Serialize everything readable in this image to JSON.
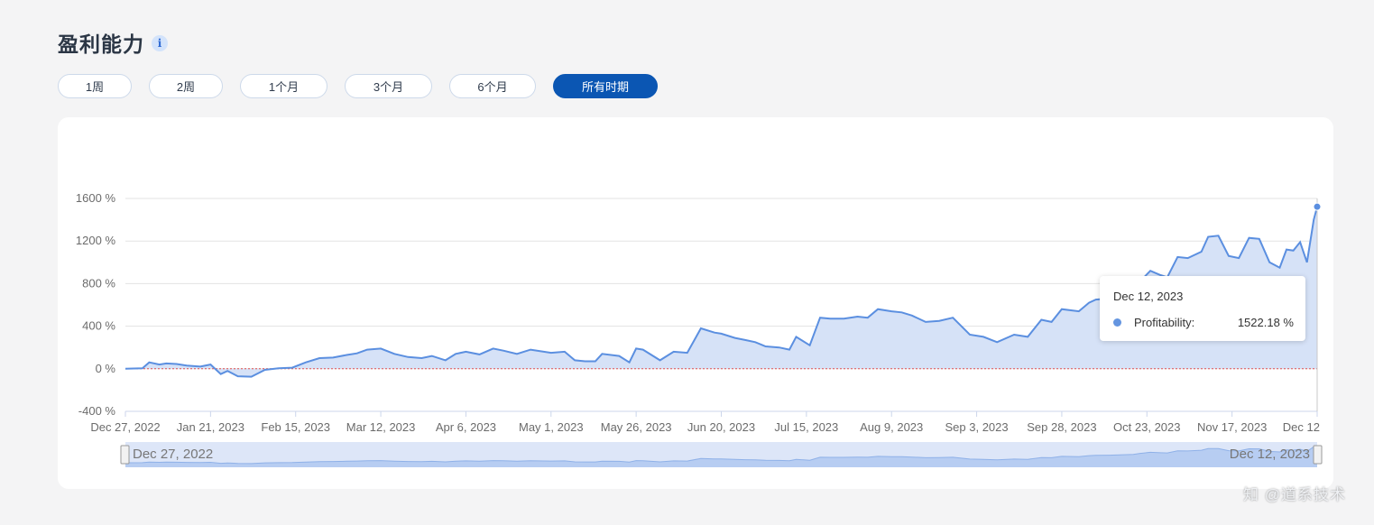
{
  "header": {
    "title": "盈利能力",
    "info_icon": "info-icon"
  },
  "periods": [
    {
      "label": "1周",
      "active": false
    },
    {
      "label": "2周",
      "active": false
    },
    {
      "label": "1个月",
      "active": false
    },
    {
      "label": "3个月",
      "active": false
    },
    {
      "label": "6个月",
      "active": false
    },
    {
      "label": "所有时期",
      "active": true
    }
  ],
  "colors": {
    "line": "#5b8fe0",
    "area": "#d6e2f7",
    "zero_line": "#e05050",
    "active_button": "#0b56b3"
  },
  "chart_data": {
    "type": "area",
    "title": "",
    "xlabel": "",
    "ylabel": "",
    "ylim": [
      -400,
      1600
    ],
    "yticks": [
      "1600 %",
      "1200 %",
      "800 %",
      "400 %",
      "0 %",
      "-400 %"
    ],
    "xticks": [
      "Dec 27, 2022",
      "Jan 21, 2023",
      "Feb 15, 2023",
      "Mar 12, 2023",
      "Apr 6, 2023",
      "May 1, 2023",
      "May 26, 2023",
      "Jun 20, 2023",
      "Jul 15, 2023",
      "Aug 9, 2023",
      "Sep 3, 2023",
      "Sep 28, 2023",
      "Oct 23, 2023",
      "Nov 17, 2023",
      "Dec 12"
    ],
    "grid": true,
    "zero_line": true,
    "series": [
      {
        "name": "Profitability",
        "x": [
          "2022-12-27",
          "2023-01-01",
          "2023-01-03",
          "2023-01-06",
          "2023-01-08",
          "2023-01-11",
          "2023-01-14",
          "2023-01-18",
          "2023-01-21",
          "2023-01-24",
          "2023-01-26",
          "2023-01-29",
          "2023-02-02",
          "2023-02-06",
          "2023-02-10",
          "2023-02-14",
          "2023-02-18",
          "2023-02-22",
          "2023-02-26",
          "2023-03-02",
          "2023-03-05",
          "2023-03-08",
          "2023-03-12",
          "2023-03-16",
          "2023-03-20",
          "2023-03-24",
          "2023-03-27",
          "2023-03-31",
          "2023-04-03",
          "2023-04-06",
          "2023-04-10",
          "2023-04-14",
          "2023-04-17",
          "2023-04-21",
          "2023-04-25",
          "2023-05-01",
          "2023-05-05",
          "2023-05-08",
          "2023-05-11",
          "2023-05-14",
          "2023-05-16",
          "2023-05-21",
          "2023-05-24",
          "2023-05-26",
          "2023-05-28",
          "2023-06-02",
          "2023-06-06",
          "2023-06-10",
          "2023-06-14",
          "2023-06-18",
          "2023-06-20",
          "2023-06-24",
          "2023-06-27",
          "2023-06-30",
          "2023-07-03",
          "2023-07-07",
          "2023-07-10",
          "2023-07-12",
          "2023-07-16",
          "2023-07-19",
          "2023-07-22",
          "2023-07-26",
          "2023-07-30",
          "2023-08-02",
          "2023-08-05",
          "2023-08-09",
          "2023-08-12",
          "2023-08-15",
          "2023-08-19",
          "2023-08-23",
          "2023-08-27",
          "2023-09-01",
          "2023-09-05",
          "2023-09-09",
          "2023-09-14",
          "2023-09-18",
          "2023-09-22",
          "2023-09-25",
          "2023-09-28",
          "2023-10-03",
          "2023-10-06",
          "2023-10-08",
          "2023-10-12",
          "2023-10-16",
          "2023-10-19",
          "2023-10-21",
          "2023-10-24",
          "2023-10-27",
          "2023-10-29",
          "2023-11-01",
          "2023-11-04",
          "2023-11-08",
          "2023-11-10",
          "2023-11-13",
          "2023-11-16",
          "2023-11-19",
          "2023-11-22",
          "2023-11-25",
          "2023-11-28",
          "2023-12-01",
          "2023-12-03",
          "2023-12-05",
          "2023-12-07",
          "2023-12-09",
          "2023-12-11",
          "2023-12-12"
        ],
        "values": [
          0,
          5,
          60,
          40,
          50,
          45,
          30,
          20,
          40,
          -50,
          -20,
          -70,
          -75,
          -10,
          5,
          10,
          60,
          100,
          105,
          130,
          145,
          180,
          190,
          140,
          110,
          100,
          120,
          80,
          140,
          160,
          135,
          190,
          170,
          140,
          180,
          150,
          160,
          80,
          70,
          70,
          140,
          120,
          60,
          190,
          180,
          80,
          160,
          150,
          380,
          340,
          330,
          290,
          270,
          250,
          210,
          200,
          180,
          300,
          220,
          480,
          470,
          470,
          490,
          480,
          560,
          540,
          530,
          500,
          440,
          450,
          480,
          320,
          300,
          250,
          320,
          300,
          460,
          440,
          560,
          540,
          620,
          650,
          660,
          700,
          730,
          820,
          920,
          880,
          860,
          1050,
          1040,
          1100,
          1240,
          1250,
          1060,
          1040,
          1230,
          1220,
          1000,
          950,
          1120,
          1110,
          1190,
          1000,
          1400,
          1522.18
        ]
      }
    ],
    "tooltip": {
      "date": "Dec 12, 2023",
      "series": "Profitability:",
      "value": "1522.18 %"
    },
    "range_selector": {
      "start_label": "Dec 27, 2022",
      "end_label": "Dec 12, 2023"
    }
  },
  "watermark": "知 @道系技术"
}
